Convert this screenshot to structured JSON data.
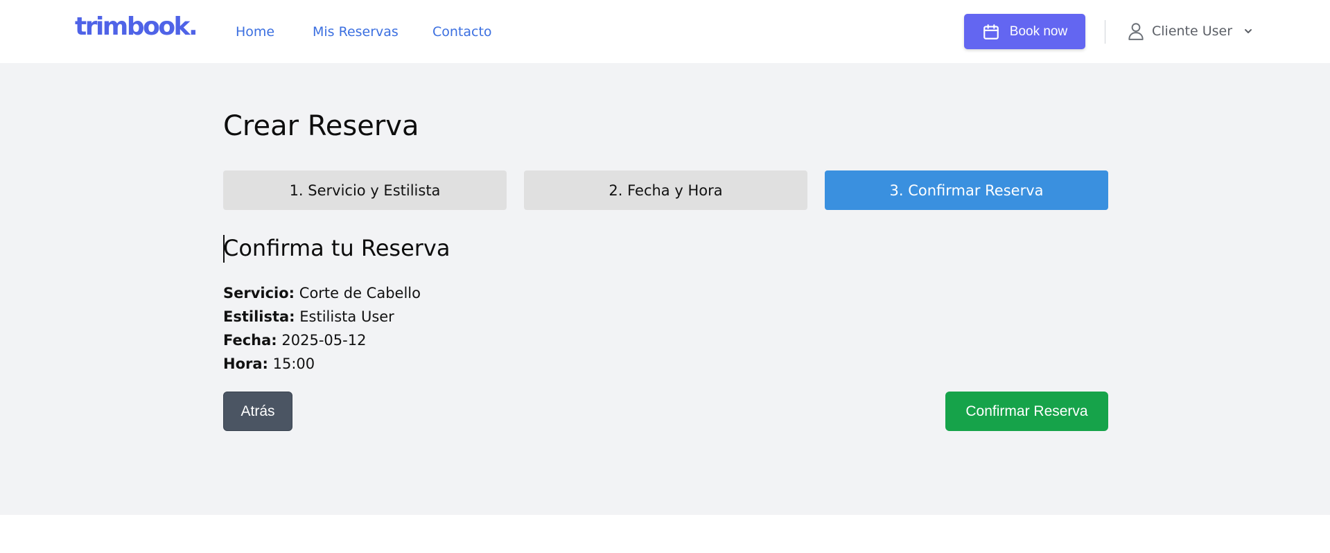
{
  "header": {
    "logo": "trimbook.",
    "nav": [
      "Home",
      "Mis Reservas",
      "Contacto"
    ],
    "book_label": "Book now",
    "user_name": "Cliente User"
  },
  "main": {
    "title": "Crear Reserva",
    "steps": [
      {
        "label": "1. Servicio y Estilista",
        "active": false
      },
      {
        "label": "2. Fecha y Hora",
        "active": false
      },
      {
        "label": "3. Confirmar Reserva",
        "active": true
      }
    ],
    "section_title": "Confirma tu Reserva",
    "details": [
      {
        "label": "Servicio:",
        "value": "Corte de Cabello"
      },
      {
        "label": "Estilista:",
        "value": "Estilista User"
      },
      {
        "label": "Fecha:",
        "value": "2025-05-12"
      },
      {
        "label": "Hora:",
        "value": "15:00"
      }
    ],
    "back_label": "Atrás",
    "confirm_label": "Confirmar Reserva"
  },
  "icons": {
    "book": "calendar-icon",
    "user": "user-icon",
    "dropdown": "chevron-down-icon"
  },
  "colors": {
    "brand": "#4f63e7",
    "nav_link": "#3b6fe0",
    "book_button": "#6366f1",
    "active_step": "#3a90df",
    "inactive_step": "#e0e0e0",
    "back_button": "#4b5563",
    "confirm_button": "#16a34a",
    "main_background": "#f2f3f5"
  }
}
